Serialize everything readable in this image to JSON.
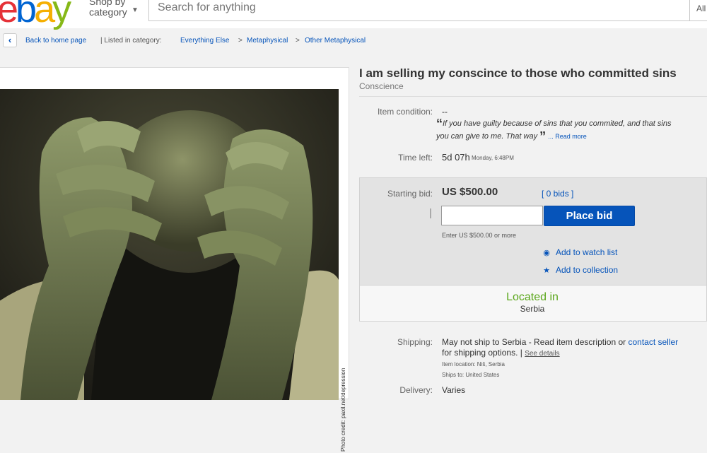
{
  "header": {
    "logo_letters": [
      "e",
      "b",
      "a",
      "y"
    ],
    "shop_by": "Shop by",
    "category": "category",
    "search_placeholder": "Search for anything",
    "all_categories": "All"
  },
  "breadcrumb": {
    "back": "Back to home page",
    "listed_in": "| Listed in category:",
    "items": [
      "Everything Else",
      ">",
      "Metaphysical",
      ">",
      "Other Metaphysical"
    ]
  },
  "photo": {
    "credit": "Photo credit: paxil.net/depression"
  },
  "listing": {
    "title": "I am selling my conscince to those who committed sins",
    "subtitle": "Conscience",
    "item_condition_label": "Item condition:",
    "item_condition_value": "--",
    "quote_open": "“",
    "quote_text_1": "If you have guilty because of sins that you commited, and that sins",
    "quote_text_2": "you can give to me. That way",
    "quote_close": "”",
    "read_more": "... Read more",
    "time_left_label": "Time left:",
    "time_left_value": "5d 07h",
    "time_left_detail": "Monday, 6:48PM"
  },
  "bid": {
    "starting_bid_label": "Starting bid:",
    "price": "US $500.00",
    "bids": "[ 0 bids ]",
    "input_value": "",
    "place_bid": "Place bid",
    "hint": "Enter US $500.00 or more",
    "watch": "Add to watch list",
    "collection": "Add to collection",
    "located_in": "Located in",
    "country": "Serbia"
  },
  "shipping": {
    "label": "Shipping:",
    "line1_pre": "May not ship to Serbia - Read item description or ",
    "contact_seller": "contact seller",
    "line2_pre": "for shipping options. | ",
    "see_details": "See details",
    "item_location": "Item location:  Niš, Serbia",
    "ships_to": "Ships to:  United States",
    "delivery_label": "Delivery:",
    "delivery_value": "Varies"
  },
  "colors": {
    "link": "#0654ba",
    "located": "#5ba71b",
    "button": "#0654ba"
  }
}
